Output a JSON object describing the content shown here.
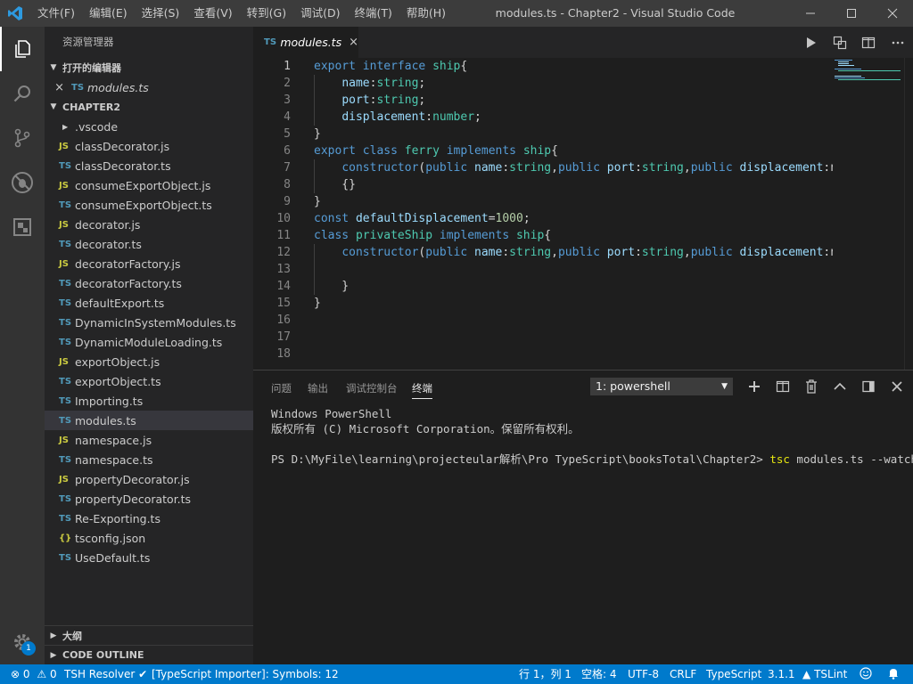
{
  "titlebar": {
    "menus": [
      "文件(F)",
      "编辑(E)",
      "选择(S)",
      "查看(V)",
      "转到(G)",
      "调试(D)",
      "终端(T)",
      "帮助(H)"
    ],
    "title": "modules.ts - Chapter2 - Visual Studio Code"
  },
  "activity": {
    "badge": "1"
  },
  "sidebar": {
    "title": "资源管理器",
    "open_editors_label": "打开的编辑器",
    "open_editor": {
      "icon": "TS",
      "name": "modules.ts"
    },
    "folder_label": "CHAPTER2",
    "files": [
      {
        "name": ".vscode",
        "type": "folder",
        "icon": ""
      },
      {
        "name": "classDecorator.js",
        "type": "js",
        "icon": "JS"
      },
      {
        "name": "classDecorator.ts",
        "type": "ts",
        "icon": "TS"
      },
      {
        "name": "consumeExportObject.js",
        "type": "js",
        "icon": "JS"
      },
      {
        "name": "consumeExportObject.ts",
        "type": "ts",
        "icon": "TS"
      },
      {
        "name": "decorator.js",
        "type": "js",
        "icon": "JS"
      },
      {
        "name": "decorator.ts",
        "type": "ts",
        "icon": "TS"
      },
      {
        "name": "decoratorFactory.js",
        "type": "js",
        "icon": "JS"
      },
      {
        "name": "decoratorFactory.ts",
        "type": "ts",
        "icon": "TS"
      },
      {
        "name": "defaultExport.ts",
        "type": "ts",
        "icon": "TS"
      },
      {
        "name": "DynamicInSystemModules.ts",
        "type": "ts",
        "icon": "TS"
      },
      {
        "name": "DynamicModuleLoading.ts",
        "type": "ts",
        "icon": "TS"
      },
      {
        "name": "exportObject.js",
        "type": "js",
        "icon": "JS"
      },
      {
        "name": "exportObject.ts",
        "type": "ts",
        "icon": "TS"
      },
      {
        "name": "Importing.ts",
        "type": "ts",
        "icon": "TS"
      },
      {
        "name": "modules.ts",
        "type": "ts",
        "icon": "TS",
        "selected": true
      },
      {
        "name": "namespace.js",
        "type": "js",
        "icon": "JS"
      },
      {
        "name": "namespace.ts",
        "type": "ts",
        "icon": "TS"
      },
      {
        "name": "propertyDecorator.js",
        "type": "js",
        "icon": "JS"
      },
      {
        "name": "propertyDecorator.ts",
        "type": "ts",
        "icon": "TS"
      },
      {
        "name": "Re-Exporting.ts",
        "type": "ts",
        "icon": "TS"
      },
      {
        "name": "tsconfig.json",
        "type": "json",
        "icon": "{}"
      },
      {
        "name": "UseDefault.ts",
        "type": "ts",
        "icon": "TS"
      }
    ],
    "outline_label": "大纲",
    "code_outline_label": "CODE OUTLINE"
  },
  "editor": {
    "tab": {
      "icon": "TS",
      "label": "modules.ts",
      "close": "×"
    },
    "line_numbers": [
      "1",
      "2",
      "3",
      "4",
      "5",
      "6",
      "7",
      "8",
      "9",
      "10",
      "11",
      "12",
      "13",
      "14",
      "15",
      "16",
      "17",
      "18"
    ],
    "lines": [
      [
        [
          "kw",
          "export "
        ],
        [
          "kw",
          "interface "
        ],
        [
          "ty",
          "ship"
        ],
        [
          "pl",
          "{"
        ]
      ],
      [
        [
          "pl",
          "    "
        ],
        [
          "pr",
          "name"
        ],
        [
          "pl",
          ":"
        ],
        [
          "ty",
          "string"
        ],
        [
          "pl",
          ";"
        ]
      ],
      [
        [
          "pl",
          "    "
        ],
        [
          "pr",
          "port"
        ],
        [
          "pl",
          ":"
        ],
        [
          "ty",
          "string"
        ],
        [
          "pl",
          ";"
        ]
      ],
      [
        [
          "pl",
          "    "
        ],
        [
          "pr",
          "displacement"
        ],
        [
          "pl",
          ":"
        ],
        [
          "ty",
          "number"
        ],
        [
          "pl",
          ";"
        ]
      ],
      [
        [
          "pl",
          "}"
        ]
      ],
      [
        [
          "kw",
          "export "
        ],
        [
          "kw",
          "class "
        ],
        [
          "ty",
          "ferry "
        ],
        [
          "kw",
          "implements "
        ],
        [
          "ty",
          "ship"
        ],
        [
          "pl",
          "{"
        ]
      ],
      [
        [
          "pl",
          "    "
        ],
        [
          "kw",
          "constructor"
        ],
        [
          "pl",
          "("
        ],
        [
          "kw",
          "public "
        ],
        [
          "pr",
          "name"
        ],
        [
          "pl",
          ":"
        ],
        [
          "ty",
          "string"
        ],
        [
          "pl",
          ","
        ],
        [
          "kw",
          "public "
        ],
        [
          "pr",
          "port"
        ],
        [
          "pl",
          ":"
        ],
        [
          "ty",
          "string"
        ],
        [
          "pl",
          ","
        ],
        [
          "kw",
          "public "
        ],
        [
          "pr",
          "displacement"
        ],
        [
          "pl",
          ":nu"
        ]
      ],
      [
        [
          "pl",
          "    {}"
        ]
      ],
      [
        [
          "pl",
          "}"
        ]
      ],
      [
        [
          "kw",
          "const "
        ],
        [
          "pr",
          "defaultDisplacement"
        ],
        [
          "pl",
          "="
        ],
        [
          "nu",
          "1000"
        ],
        [
          "pl",
          ";"
        ]
      ],
      [
        [
          "kw",
          "class "
        ],
        [
          "ty",
          "privateShip "
        ],
        [
          "kw",
          "implements "
        ],
        [
          "ty",
          "ship"
        ],
        [
          "pl",
          "{"
        ]
      ],
      [
        [
          "pl",
          "    "
        ],
        [
          "kw",
          "constructor"
        ],
        [
          "pl",
          "("
        ],
        [
          "kw",
          "public "
        ],
        [
          "pr",
          "name"
        ],
        [
          "pl",
          ":"
        ],
        [
          "ty",
          "string"
        ],
        [
          "pl",
          ","
        ],
        [
          "kw",
          "public "
        ],
        [
          "pr",
          "port"
        ],
        [
          "pl",
          ":"
        ],
        [
          "ty",
          "string"
        ],
        [
          "pl",
          ","
        ],
        [
          "kw",
          "public "
        ],
        [
          "pr",
          "displacement"
        ],
        [
          "pl",
          ":nu"
        ]
      ],
      [
        [
          "pl",
          ""
        ]
      ],
      [
        [
          "pl",
          "    }"
        ]
      ],
      [
        [
          "pl",
          "}"
        ]
      ],
      [
        [
          "pl",
          ""
        ]
      ],
      [
        [
          "pl",
          ""
        ]
      ],
      [
        [
          "pl",
          ""
        ]
      ]
    ]
  },
  "panel": {
    "tabs": [
      "问题",
      "输出",
      "调试控制台",
      "终端"
    ],
    "terminal_select": "1: powershell",
    "terminal": {
      "line1": "Windows PowerShell",
      "line2": "版权所有 (C) Microsoft Corporation。保留所有权利。",
      "prompt": "PS D:\\MyFile\\learning\\projecteular解析\\Pro TypeScript\\booksTotal\\Chapter2> ",
      "command": "tsc",
      "args": " modules.ts --watch"
    }
  },
  "statusbar": {
    "errors": "0",
    "warnings": "0",
    "tsh": "TSH Resolver",
    "importer": "[TypeScript Importer]: Symbols: 12",
    "position": "行 1，列 1",
    "spaces": "空格: 4",
    "encoding": "UTF-8",
    "eol": "CRLF",
    "language": "TypeScript",
    "version": "3.1.1",
    "tslint": "TSLint"
  },
  "colors": {
    "accent": "#007acc",
    "keyword": "#569cd6",
    "type": "#4ec9b0",
    "property": "#9cdcfe",
    "number": "#b5cea8"
  }
}
